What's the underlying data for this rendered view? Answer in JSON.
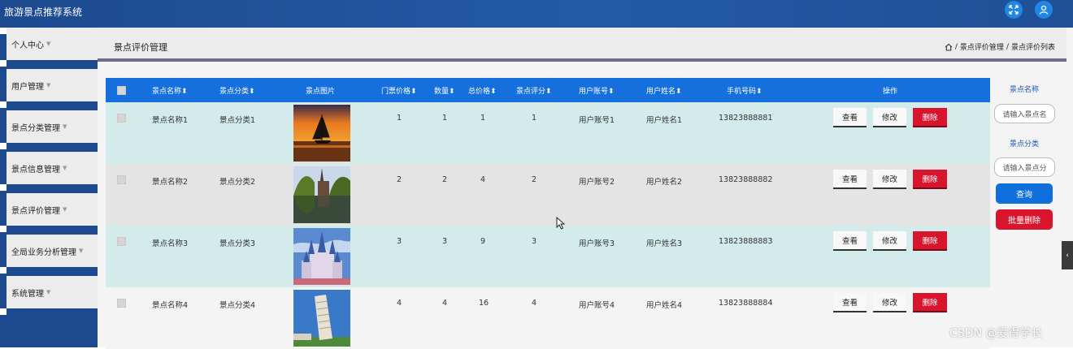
{
  "app": {
    "title": "旅游景点推荐系统"
  },
  "topbar": {
    "icons": [
      "expand-icon",
      "user-icon"
    ]
  },
  "sidebar": {
    "items": [
      {
        "label": "个人中心"
      },
      {
        "label": "用户管理"
      },
      {
        "label": "景点分类管理"
      },
      {
        "label": "景点信息管理"
      },
      {
        "label": "景点评价管理"
      },
      {
        "label": "全局业务分析管理"
      },
      {
        "label": "系统管理"
      }
    ]
  },
  "header": {
    "title": "景点评价管理",
    "breadcrumb": {
      "sep1": "/",
      "item1": "景点评价管理",
      "sep2": "/",
      "item2": "景点评价列表"
    }
  },
  "table": {
    "columns": [
      "景点名称",
      "景点分类",
      "景点图片",
      "门票价格",
      "数量",
      "总价格",
      "景点评分",
      "用户账号",
      "用户姓名",
      "手机号码",
      "操作"
    ],
    "sort_indicator": "⬍",
    "rows": [
      {
        "name": "景点名称1",
        "category": "景点分类1",
        "image": "sunset-sailboat",
        "price": "1",
        "quantity": "1",
        "total": "1",
        "rating": "1",
        "account": "用户账号1",
        "user_name": "用户姓名1",
        "phone": "13823888881"
      },
      {
        "name": "景点名称2",
        "category": "景点分类2",
        "image": "lake-church",
        "price": "2",
        "quantity": "2",
        "total": "4",
        "rating": "2",
        "account": "用户账号2",
        "user_name": "用户姓名2",
        "phone": "13823888882"
      },
      {
        "name": "景点名称3",
        "category": "景点分类3",
        "image": "fairytale-castle",
        "price": "3",
        "quantity": "3",
        "total": "9",
        "rating": "3",
        "account": "用户账号3",
        "user_name": "用户姓名3",
        "phone": "13823888883"
      },
      {
        "name": "景点名称4",
        "category": "景点分类4",
        "image": "leaning-tower",
        "price": "4",
        "quantity": "4",
        "total": "16",
        "rating": "4",
        "account": "用户账号4",
        "user_name": "用户姓名4",
        "phone": "13823888884"
      }
    ],
    "actions": {
      "view": "查看",
      "edit": "修改",
      "delete": "删除"
    }
  },
  "search": {
    "name_label": "景点名称",
    "name_placeholder": "请输入景点名",
    "category_label": "景点分类",
    "category_placeholder": "请输入景点分",
    "search_button": "查询",
    "batch_delete_button": "批量删除"
  },
  "colors": {
    "topbar": "#1d4a8f",
    "table_header": "#1570de",
    "delete": "#d8152d",
    "search": "#0f6fdc"
  },
  "watermark": "CSDN @爱得学长"
}
